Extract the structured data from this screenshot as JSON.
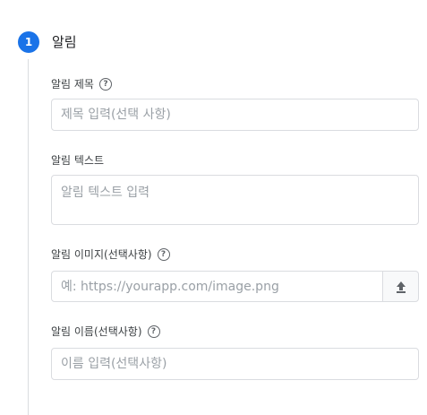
{
  "step": {
    "number": "1",
    "title": "알림"
  },
  "fields": {
    "title": {
      "label": "알림 제목",
      "placeholder": "제목 입력(선택 사항)",
      "help": "?"
    },
    "text": {
      "label": "알림 텍스트",
      "placeholder": "알림 텍스트 입력"
    },
    "image": {
      "label": "알림 이미지(선택사항)",
      "placeholder": "예: https://yourapp.com/image.png",
      "help": "?"
    },
    "name": {
      "label": "알림 이름(선택사항)",
      "placeholder": "이름 입력(선택사항)",
      "help": "?"
    }
  },
  "icons": {
    "upload": "upload-icon",
    "help": "help-circle-icon"
  },
  "colors": {
    "accent": "#1a73e8",
    "border": "#dadce0",
    "placeholder": "#9aa0a6"
  }
}
